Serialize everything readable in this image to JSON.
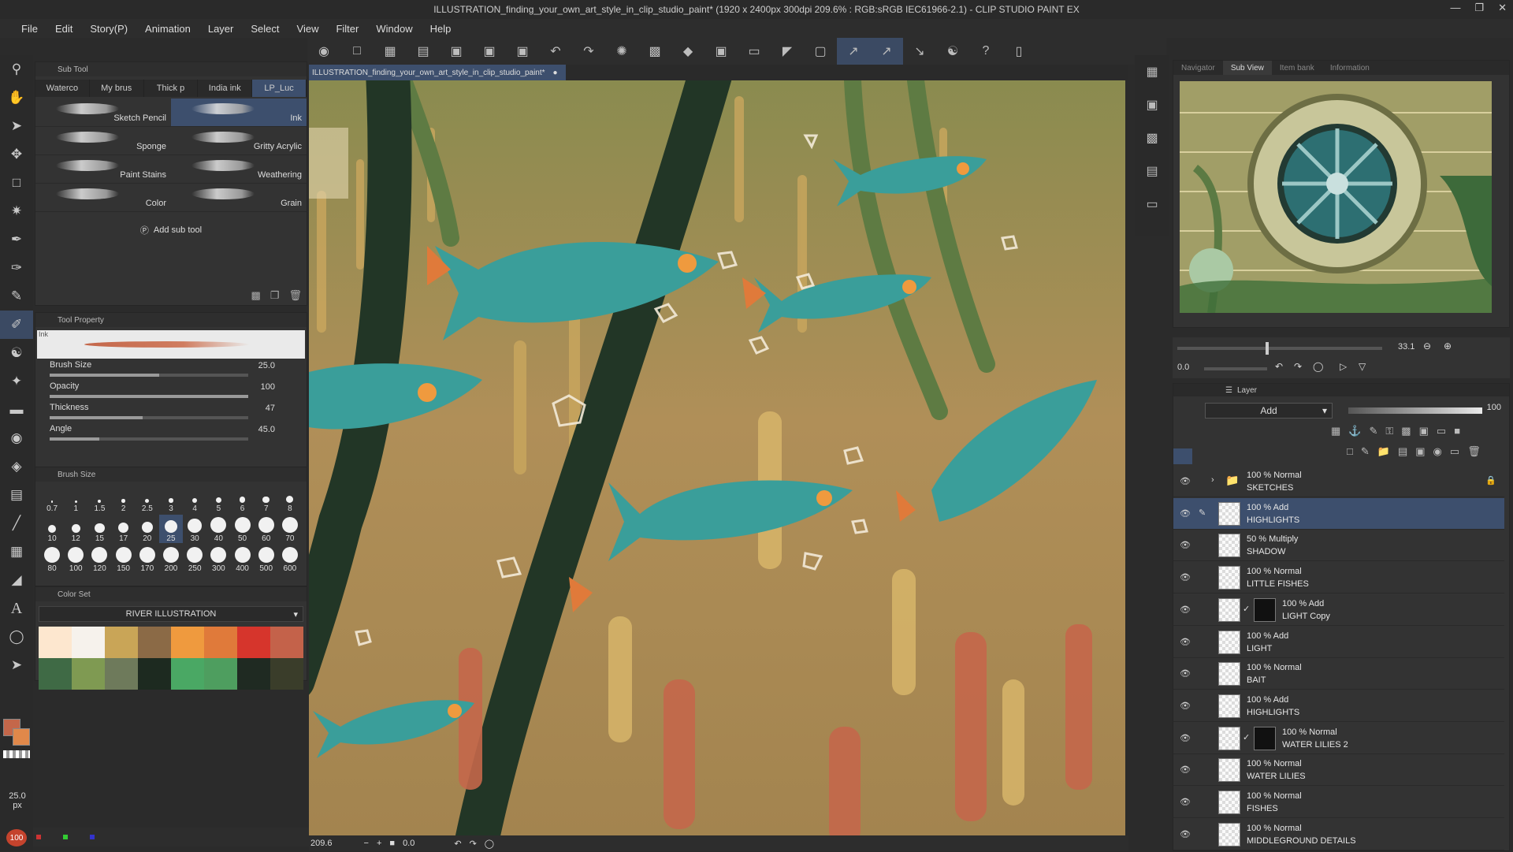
{
  "window": {
    "title": "ILLUSTRATION_finding_your_own_art_style_in_clip_studio_paint* (1920 x 2400px 300dpi 209.6% : RGB:sRGB IEC61966-2.1) - CLIP STUDIO PAINT EX"
  },
  "menu": [
    "File",
    "Edit",
    "Story(P)",
    "Animation",
    "Layer",
    "Select",
    "View",
    "Filter",
    "Window",
    "Help"
  ],
  "subtool": {
    "header": "Sub Tool",
    "tabs": [
      "Waterco",
      "My brus",
      "Thick p",
      "India ink",
      "LP_Luc"
    ],
    "brushes": [
      {
        "name": "Sketch Pencil"
      },
      {
        "name": "Ink"
      },
      {
        "name": "Sponge"
      },
      {
        "name": "Gritty Acrylic"
      },
      {
        "name": "Paint Stains"
      },
      {
        "name": "Weathering"
      },
      {
        "name": "Color"
      },
      {
        "name": "Grain"
      }
    ],
    "add_label": "Add sub tool"
  },
  "tool_property": {
    "header": "Tool Property",
    "preview_tag": "Ink",
    "props": [
      {
        "label": "Brush Size",
        "value": "25.0",
        "fill": 0.55
      },
      {
        "label": "Opacity",
        "value": "100",
        "fill": 1.0
      },
      {
        "label": "Thickness",
        "value": "47",
        "fill": 0.47
      },
      {
        "label": "Angle",
        "value": "45.0",
        "fill": 0.25
      }
    ]
  },
  "brush_size": {
    "header": "Brush Size",
    "sizes": [
      "0.7",
      "1",
      "1.5",
      "2",
      "2.5",
      "3",
      "4",
      "5",
      "6",
      "7",
      "8",
      "10",
      "12",
      "15",
      "17",
      "20",
      "25",
      "30",
      "40",
      "50",
      "60",
      "70",
      "80",
      "100",
      "120",
      "150",
      "170",
      "200",
      "250",
      "300",
      "400",
      "500",
      "600"
    ],
    "selected": "25"
  },
  "color_set": {
    "header": "Color Set",
    "name": "RIVER ILLUSTRATION",
    "swatches": [
      "#fde7cf",
      "#f6f2ec",
      "#c9a557",
      "#8b6a46",
      "#ef9a3e",
      "#e07a3a",
      "#d6352c",
      "#c4624a",
      "#3f6a45",
      "#7f9a52",
      "#6e7a5b",
      "#1d2a20",
      "#4aa864",
      "#4e9e5f",
      "#1f2a22",
      "#3a3d2a"
    ]
  },
  "tool_options": {
    "zoom_value": "25.0",
    "zoom_unit": "px",
    "opacity_value": "100"
  },
  "document": {
    "tab": "ILLUSTRATION_finding_your_own_art_style_in_clip_studio_paint*"
  },
  "status": {
    "zoom": "209.6",
    "angle": "0.0"
  },
  "navigator": {
    "tabs": [
      "Navigator",
      "Sub View",
      "Item bank",
      "Information"
    ],
    "zoom": "33.1",
    "rotate": "0.0"
  },
  "layers": {
    "header": "Layer",
    "blend_mode": "Add",
    "opacity": "100",
    "rows": [
      {
        "mode": "100 % Normal",
        "name": "SKETCHES",
        "folder": true
      },
      {
        "mode": "100 % Add",
        "name": "HIGHLIGHTS",
        "selected": true
      },
      {
        "mode": "50 % Multiply",
        "name": "SHADOW"
      },
      {
        "mode": "100 % Normal",
        "name": "LITTLE FISHES"
      },
      {
        "mode": "100 % Add",
        "name": "LIGHT Copy",
        "clip": true
      },
      {
        "mode": "100 % Add",
        "name": "LIGHT"
      },
      {
        "mode": "100 % Normal",
        "name": "BAIT"
      },
      {
        "mode": "100 % Add",
        "name": "HIGHLIGHTS"
      },
      {
        "mode": "100 % Normal",
        "name": "WATER LILIES 2",
        "clip": true
      },
      {
        "mode": "100 % Normal",
        "name": "WATER LILIES"
      },
      {
        "mode": "100 % Normal",
        "name": "FISHES"
      },
      {
        "mode": "100 % Normal",
        "name": "MIDDLEGROUND DETAILS"
      }
    ]
  },
  "colors": {
    "accent": "#3d4f6d",
    "panel": "#333333",
    "main_color": "#c4674a",
    "sub_color": "#e0884a"
  },
  "icons": [
    "magnifier-icon",
    "hand-icon",
    "move-icon",
    "marquee-icon",
    "wand-icon",
    "eyedropper-icon",
    "pen-icon",
    "pencil-icon",
    "brush-icon",
    "eraser-icon",
    "fill-icon",
    "gradient-icon",
    "text-icon",
    "eye-icon",
    "folder-icon",
    "lock-icon"
  ]
}
